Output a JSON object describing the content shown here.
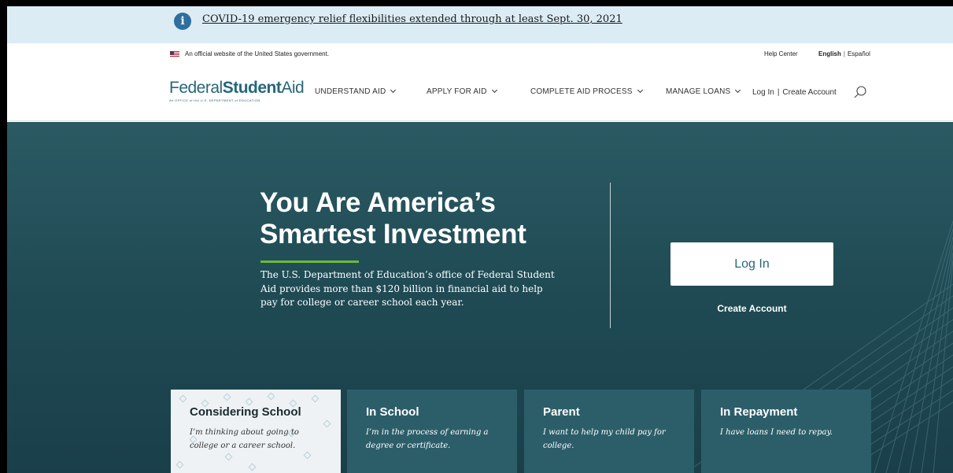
{
  "alert": {
    "icon": "info-icon",
    "icon_glyph": "i",
    "link_text": "COVID-19 emergency relief flexibilities extended through at least Sept. 30, 2021"
  },
  "official_bar": {
    "text": "An official website of the United States government.",
    "help_center": "Help Center",
    "lang_english": "English",
    "lang_separator": "|",
    "lang_spanish": "Español"
  },
  "nav": {
    "logo_light": "Federal",
    "logo_bold": "Student",
    "logo_light2": "Aid",
    "logo_sub": "An OFFICE of the U.S. DEPARTMENT of EDUCATION",
    "items": [
      {
        "label": "UNDERSTAND AID"
      },
      {
        "label": "APPLY FOR AID"
      },
      {
        "label": "COMPLETE AID PROCESS"
      },
      {
        "label": "MANAGE LOANS"
      }
    ],
    "login": "Log In",
    "login_sep": "|",
    "create_account": "Create Account"
  },
  "hero": {
    "title_line1": "You Are America’s",
    "title_line2": "Smartest Investment",
    "description": "The U.S. Department of Education’s office of Federal Student Aid provides more than $120 billion in financial aid to help pay for college or career school each year.",
    "login_button": "Log In",
    "create_account": "Create Account"
  },
  "cards": [
    {
      "title": "Considering School",
      "desc": "I’m thinking about going to college or a career school."
    },
    {
      "title": "In School",
      "desc": "I’m in the process of earning a degree or certificate."
    },
    {
      "title": "Parent",
      "desc": "I want to help my child pay for college."
    },
    {
      "title": "In Repayment",
      "desc": "I have loans I need to repay."
    }
  ],
  "colors": {
    "alert_bg": "#dcecf5",
    "brand_teal": "#26677a",
    "hero_bg": "#1f4a54",
    "accent_green": "#6fb73a",
    "card_bg": "#2c5e6a",
    "card_active_bg": "#eef2f4"
  }
}
